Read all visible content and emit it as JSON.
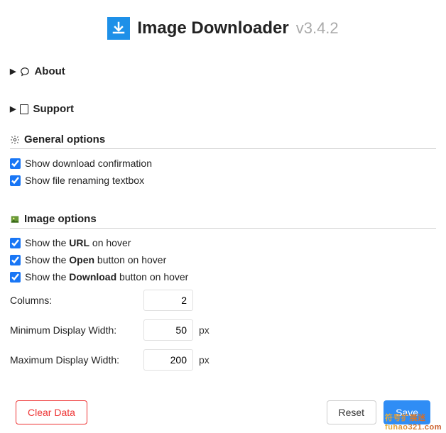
{
  "header": {
    "title": "Image Downloader",
    "version": "v3.4.2"
  },
  "accordions": {
    "about": "About",
    "support": "Support"
  },
  "general": {
    "title": "General options",
    "show_download_confirmation": {
      "label": "Show download confirmation",
      "checked": true
    },
    "show_file_renaming": {
      "label": "Show file renaming textbox",
      "checked": true
    }
  },
  "image": {
    "title": "Image options",
    "show_url": {
      "prefix": "Show the ",
      "bold": "URL",
      "suffix": " on hover",
      "checked": true
    },
    "show_open": {
      "prefix": "Show the ",
      "bold": "Open",
      "suffix": " button on hover",
      "checked": true
    },
    "show_download": {
      "prefix": "Show the ",
      "bold": "Download",
      "suffix": " button on hover",
      "checked": true
    },
    "columns": {
      "label": "Columns:",
      "value": "2"
    },
    "min_width": {
      "label": "Minimum Display Width:",
      "value": "50",
      "unit": "px"
    },
    "max_width": {
      "label": "Maximum Display Width:",
      "value": "200",
      "unit": "px"
    }
  },
  "buttons": {
    "clear": "Clear Data",
    "reset": "Reset",
    "save": "Save"
  },
  "watermark": {
    "line1": "符号扩展迷",
    "line2": "fuhao321.com"
  }
}
